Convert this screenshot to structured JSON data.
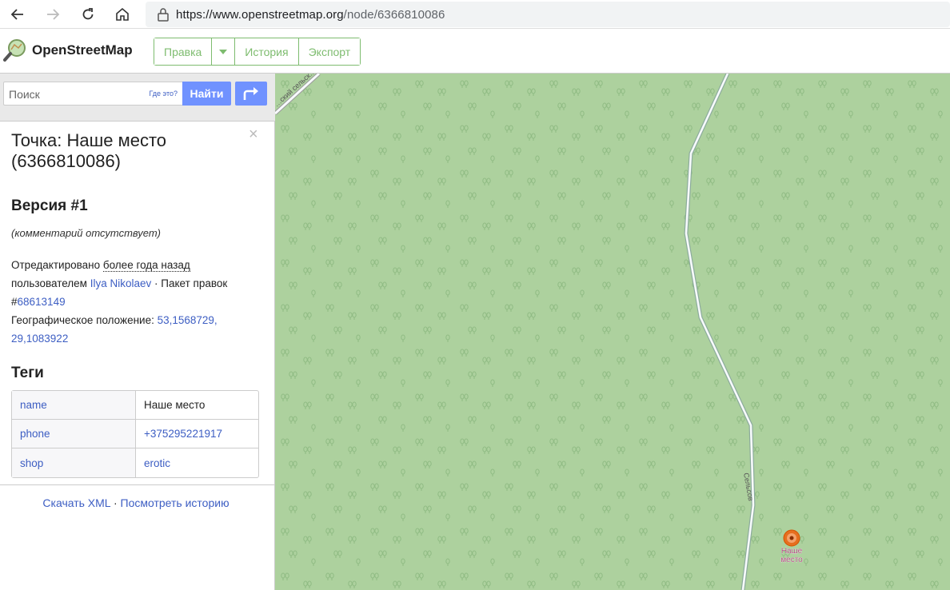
{
  "browser": {
    "url_host": "https://www.openstreetmap.org",
    "url_path": "/node/6366810086"
  },
  "header": {
    "logo_text": "OpenStreetMap",
    "tabs": {
      "edit": "Правка",
      "history": "История",
      "export": "Экспорт"
    }
  },
  "search": {
    "placeholder": "Поиск",
    "where_link": "Где это?",
    "find_button": "Найти"
  },
  "node": {
    "title": "Точка: Наше место (6366810086)",
    "version": "Версия #1",
    "comment": "(комментарий отсутствует)",
    "edited_prefix": "Отредактировано",
    "edited_time": "более года назад",
    "by_prefix": "пользователем",
    "user": "Ilya Nikolaev",
    "changeset_prefix": "· Пакет правок #",
    "changeset": "68613149",
    "location_prefix": "Географическое положение:",
    "location_lat": "53,1568729,",
    "location_lon": "29,1083922"
  },
  "tags": {
    "heading": "Теги",
    "rows": [
      {
        "key": "name",
        "value": "Наше место"
      },
      {
        "key": "phone",
        "value": "+375295221917"
      },
      {
        "key": "shop",
        "value": "erotic"
      }
    ]
  },
  "footer": {
    "download_xml": "Скачать XML",
    "separator": "·",
    "view_history": "Посмотреть историю"
  },
  "map": {
    "road_label_top": "…ский сельск…",
    "road_label": "Сельсов",
    "poi_label_1": "Наше",
    "poi_label_2": "место",
    "colors": {
      "forest": "#add19e",
      "tree_mark": "#8fbb83",
      "road": "#f7fafc",
      "poi": "#e66e1f"
    }
  }
}
